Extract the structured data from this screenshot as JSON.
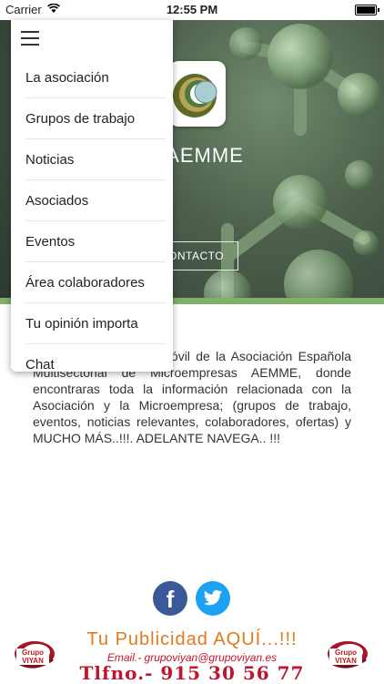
{
  "status_bar": {
    "carrier": "Carrier",
    "time": "12:55 PM"
  },
  "header": {
    "title": "AEMME",
    "contact_button": "CONTACTO"
  },
  "menu": {
    "items": [
      {
        "label": "La asociación"
      },
      {
        "label": "Grupos de trabajo"
      },
      {
        "label": "Noticias"
      },
      {
        "label": "Asociados"
      },
      {
        "label": "Eventos"
      },
      {
        "label": "Área colaboradores"
      },
      {
        "label": "Tu opinión importa"
      },
      {
        "label": "Chat"
      }
    ]
  },
  "main": {
    "intro_text": "Bienvenido a la APP Móvil de la Asociación Española Multisectorial de Microempresas AEMME, donde encontraras toda la información relacionada con la Asociación y la Microempresa; (grupos de trabajo, eventos, noticias relevantes, colaboradores, ofertas) y MUCHO MÁS..!!!. ADELANTE NAVEGA.. !!!"
  },
  "social": {
    "facebook_icon": "f",
    "twitter_icon": "twitter-bird"
  },
  "ad": {
    "headline": "Tu Publicidad AQUÍ...!!!",
    "email": "Email.- grupoviyan@grupoviyan.es",
    "phone": "Tlfno.- 915 30 56 77",
    "logo_text": "Grupo VIYAN"
  },
  "colors": {
    "accent_green": "#7fb069",
    "facebook": "#3b5998",
    "twitter": "#1da1f2",
    "ad_orange": "#e07a1c",
    "ad_red": "#c0152d"
  }
}
